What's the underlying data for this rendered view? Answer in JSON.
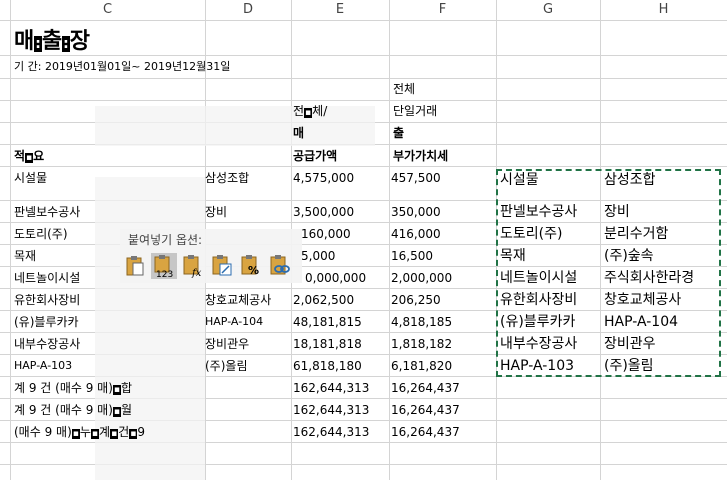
{
  "columns": [
    "C",
    "D",
    "E",
    "F",
    "G",
    "H"
  ],
  "title": {
    "p1": "매",
    "p2": "출",
    "p3": "장"
  },
  "period": "기 간: 2019년01월01일~ 2019년12월31일",
  "header": {
    "total1": "전체",
    "e_line1": "전",
    "e_line1_mid": "체/",
    "f_line1": "단일거래",
    "e_line2": "매",
    "f_line2": "출",
    "c_label_a": "적",
    "c_label_b": "요",
    "e_label": "공급가액",
    "f_label": "부가가치세"
  },
  "rows": [
    {
      "c": "시설물",
      "d": "삼성조합",
      "e": "4,575,000",
      "f": "457,500"
    },
    {
      "c": "판넬보수공사",
      "d": "장비",
      "e": "3,500,000",
      "f": "350,000"
    },
    {
      "c": "도토리(주)",
      "d": "",
      "e": "",
      "f": "416,000"
    },
    {
      "c": "목재",
      "d": "",
      "e": "",
      "f": "16,500"
    },
    {
      "c": "네트놀이시설",
      "d": "",
      "e": "",
      "f": "2,000,000"
    },
    {
      "c": "유한회사장비",
      "d": "창호교체공사",
      "e": "2,062,500",
      "f": "206,250"
    },
    {
      "c": "(유)블루카카",
      "d": "HAP-A-104",
      "e": "48,181,815",
      "f": "4,818,185"
    },
    {
      "c": "내부수장공사",
      "d": "장비관우",
      "e": "18,181,818",
      "f": "1,818,182"
    },
    {
      "c": "HAP-A-103",
      "d": "(주)올림",
      "e": "61,818,180",
      "f": "6,181,820"
    }
  ],
  "partials": {
    "r3_e": "160,000",
    "r4_e": "5,000",
    "r5_e": "0,000,000"
  },
  "totals": [
    {
      "c_a": "계 9 건 (매수 9 매)",
      "c_b": "합",
      "e": "162,644,313",
      "f": "16,264,437"
    },
    {
      "c_a": "계 9 건 (매수 9 매)",
      "c_b": "월",
      "e": "162,644,313",
      "f": "16,264,437"
    },
    {
      "c_a": "(매수 9 매)",
      "c_b": "누",
      "c_c": "계",
      "c_d": "건",
      "c_e": "9",
      "e": "162,644,313",
      "f": "16,264,437"
    }
  ],
  "gh": [
    {
      "g": "시설물",
      "h": "삼성조합"
    },
    {
      "g": "판넬보수공사",
      "h": "장비"
    },
    {
      "g": "도토리(주)",
      "h": "분리수거함"
    },
    {
      "g": "목재",
      "h": "(주)숲속"
    },
    {
      "g": "네트놀이시설",
      "h": "주식회사한라경"
    },
    {
      "g": "유한회사장비",
      "h": "창호교체공사"
    },
    {
      "g": "(유)블루카카",
      "h": "HAP-A-104"
    },
    {
      "g": "내부수장공사",
      "h": "장비관우"
    },
    {
      "g": "HAP-A-103",
      "h": "(주)올림"
    }
  ],
  "paste_options": {
    "label": "붙여넣기 옵션:",
    "icons": [
      "paste-icon",
      "paste-values-icon",
      "paste-formulas-icon",
      "paste-transpose-icon",
      "paste-formatting-icon",
      "paste-link-icon"
    ],
    "badge": "123",
    "fx": "fx"
  },
  "accent": "#217346"
}
